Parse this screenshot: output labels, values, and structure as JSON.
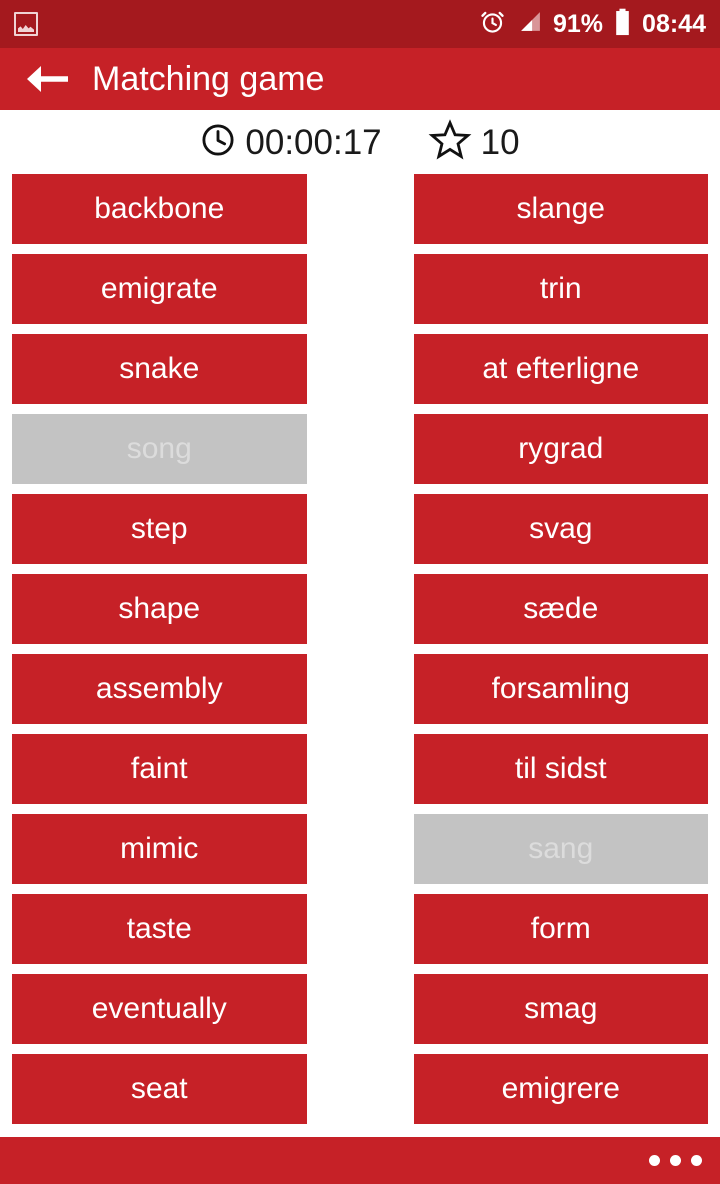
{
  "status_bar": {
    "background": "#a4191e",
    "notification_icon": "screenshot-icon",
    "alarm_icon": "alarm-clock-icon",
    "signal_icon": "signal-strength-icon",
    "battery_percent": "91%",
    "battery_icon": "battery-icon",
    "clock": "08:44"
  },
  "toolbar": {
    "background": "#c62127",
    "back_icon": "back-arrow-icon",
    "title": "Matching game"
  },
  "score": {
    "timer_icon": "clock-icon",
    "timer": "00:00:17",
    "star_icon": "star-icon",
    "stars": "10"
  },
  "board": {
    "card_color": "#c62127",
    "matched_color": "#c3c3c3",
    "left_column": [
      {
        "label": "backbone",
        "matched": false
      },
      {
        "label": "emigrate",
        "matched": false
      },
      {
        "label": "snake",
        "matched": false
      },
      {
        "label": "song",
        "matched": true
      },
      {
        "label": "step",
        "matched": false
      },
      {
        "label": "shape",
        "matched": false
      },
      {
        "label": "assembly",
        "matched": false
      },
      {
        "label": "faint",
        "matched": false
      },
      {
        "label": "mimic",
        "matched": false
      },
      {
        "label": "taste",
        "matched": false
      },
      {
        "label": "eventually",
        "matched": false
      },
      {
        "label": "seat",
        "matched": false
      }
    ],
    "right_column": [
      {
        "label": "slange",
        "matched": false
      },
      {
        "label": "trin",
        "matched": false
      },
      {
        "label": "at efterligne",
        "matched": false
      },
      {
        "label": "rygrad",
        "matched": false
      },
      {
        "label": "svag",
        "matched": false
      },
      {
        "label": "sæde",
        "matched": false
      },
      {
        "label": "forsamling",
        "matched": false
      },
      {
        "label": "til sidst",
        "matched": false
      },
      {
        "label": "sang",
        "matched": true
      },
      {
        "label": "form",
        "matched": false
      },
      {
        "label": "smag",
        "matched": false
      },
      {
        "label": "emigrere",
        "matched": false
      }
    ]
  },
  "bottom_bar": {
    "background": "#c62127",
    "overflow_icon": "overflow-menu-icon"
  }
}
